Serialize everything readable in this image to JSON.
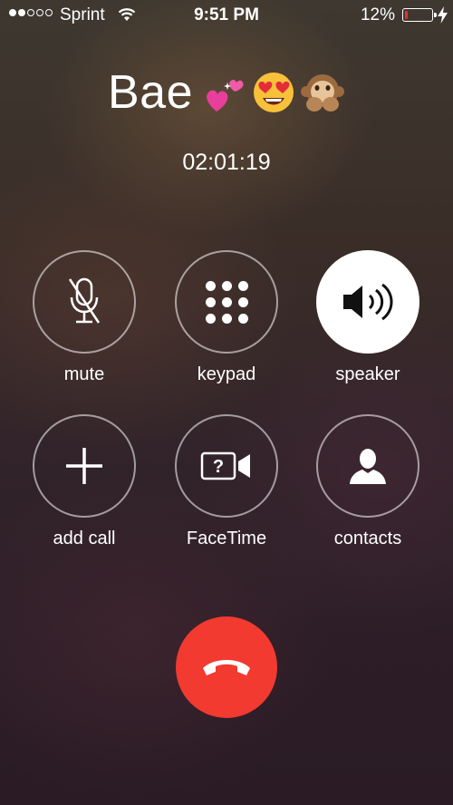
{
  "status_bar": {
    "carrier": "Sprint",
    "time": "9:51 PM",
    "battery_percent": "12%",
    "battery_level": 0.12,
    "signal_bars_filled": 2,
    "signal_bars_total": 5,
    "icons": [
      "wifi-icon",
      "battery-icon",
      "charging-bolt-icon"
    ]
  },
  "call": {
    "caller_name": "Bae",
    "caller_emojis": [
      "sparkling-hearts-emoji",
      "heart-eyes-emoji",
      "speak-no-evil-monkey-emoji"
    ],
    "duration": "02:01:19"
  },
  "buttons": [
    {
      "label": "mute",
      "icon": "microphone-muted-icon",
      "active": false
    },
    {
      "label": "keypad",
      "icon": "keypad-icon",
      "active": false
    },
    {
      "label": "speaker",
      "icon": "speaker-icon",
      "active": true
    },
    {
      "label": "add call",
      "icon": "plus-icon",
      "active": false
    },
    {
      "label": "FaceTime",
      "icon": "facetime-icon",
      "active": false
    },
    {
      "label": "contacts",
      "icon": "contact-silhouette-icon",
      "active": false
    }
  ],
  "end_call": {
    "icon": "phone-hangup-icon"
  },
  "colors": {
    "end_call_red": "#f23a30",
    "battery_red": "#e8302a",
    "speaker_active_bg": "#ffffff"
  }
}
